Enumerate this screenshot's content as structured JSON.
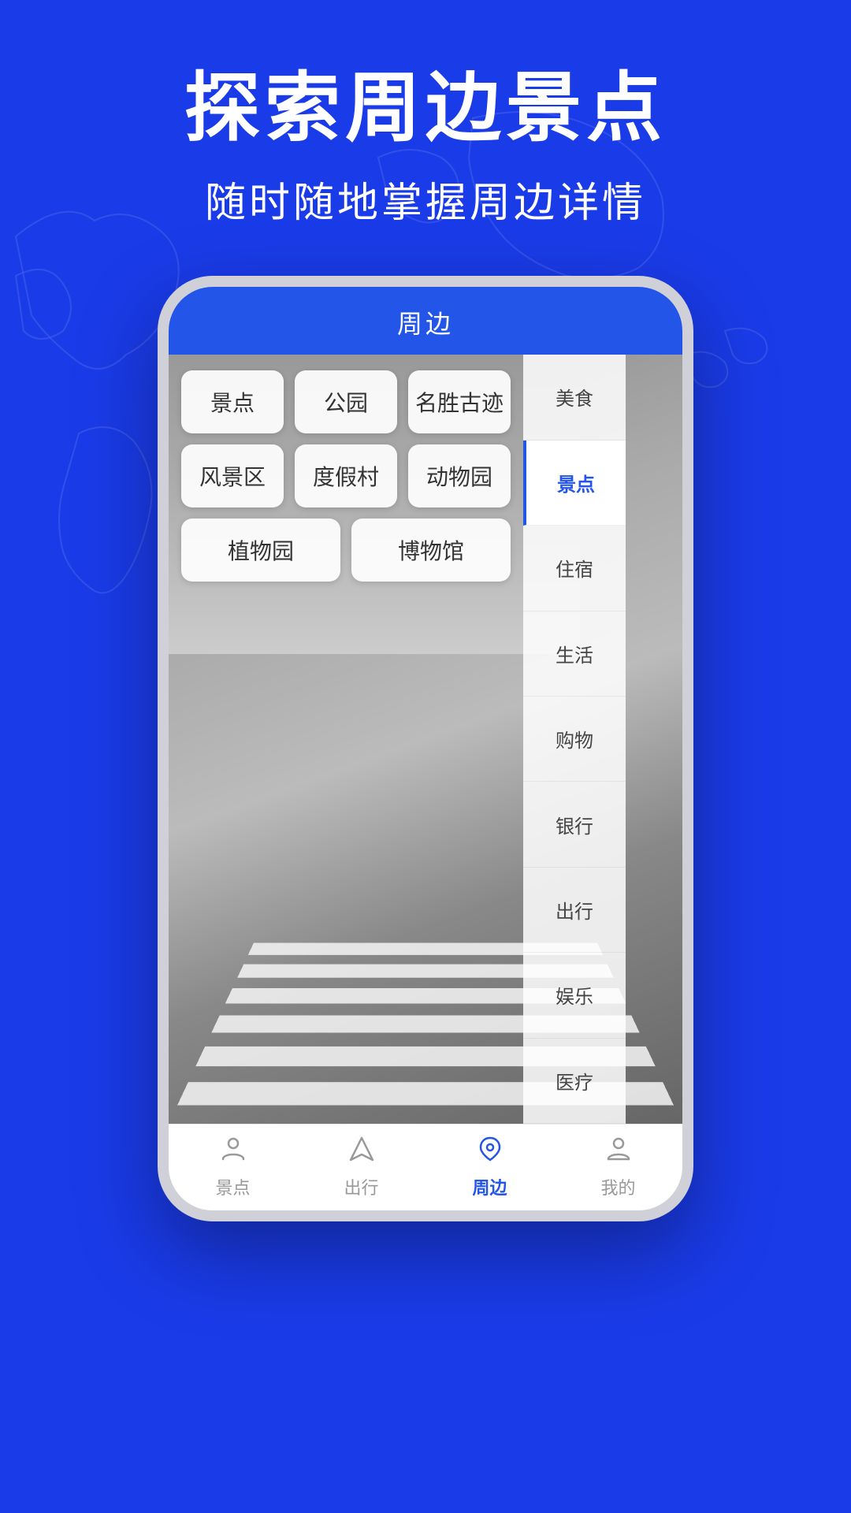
{
  "hero": {
    "title": "探索周边景点",
    "subtitle": "随时随地掌握周边详情"
  },
  "phone": {
    "topbar_title": "周边",
    "categories": [
      [
        "景点",
        "公园",
        "名胜古迹"
      ],
      [
        "风景区",
        "度假村",
        "动物园"
      ],
      [
        "植物园",
        "博物馆"
      ]
    ],
    "sidebar_items": [
      {
        "label": "美食",
        "active": false
      },
      {
        "label": "景点",
        "active": true
      },
      {
        "label": "住宿",
        "active": false
      },
      {
        "label": "生活",
        "active": false
      },
      {
        "label": "购物",
        "active": false
      },
      {
        "label": "银行",
        "active": false
      },
      {
        "label": "出行",
        "active": false
      },
      {
        "label": "娱乐",
        "active": false
      },
      {
        "label": "医疗",
        "active": false
      }
    ],
    "bottom_nav": [
      {
        "label": "景点",
        "icon": "person",
        "active": false
      },
      {
        "label": "出行",
        "icon": "navigate",
        "active": false
      },
      {
        "label": "周边",
        "icon": "location",
        "active": true
      },
      {
        "label": "我的",
        "icon": "user",
        "active": false
      }
    ]
  }
}
